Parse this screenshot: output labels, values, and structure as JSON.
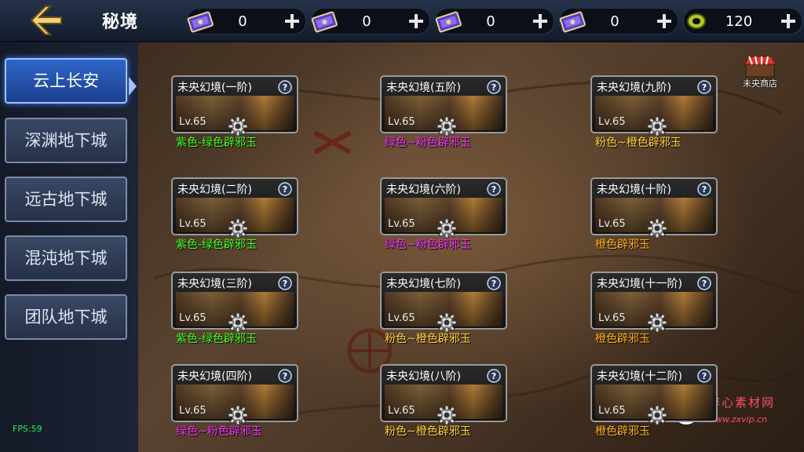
{
  "header": {
    "title": "秘境",
    "currencies": [
      {
        "icon": "purple-ticket-icon",
        "value": "0"
      },
      {
        "icon": "purple-ticket-icon",
        "value": "0"
      },
      {
        "icon": "purple-ticket-icon",
        "value": "0"
      },
      {
        "icon": "purple-ticket-icon",
        "value": "0"
      },
      {
        "icon": "gold-ring-coin-icon",
        "value": "120"
      }
    ]
  },
  "sidebar": {
    "items": [
      {
        "label": "云上长安",
        "active": true
      },
      {
        "label": "深渊地下城",
        "active": false
      },
      {
        "label": "远古地下城",
        "active": false
      },
      {
        "label": "混沌地下城",
        "active": false
      },
      {
        "label": "团队地下城",
        "active": false
      }
    ]
  },
  "shop": {
    "label": "未央商店"
  },
  "cards": [
    {
      "title": "未央幻境(一阶)",
      "level": "Lv.65",
      "reward": "紫色-绿色辟邪玉"
    },
    {
      "title": "未央幻境(五阶)",
      "level": "Lv.65",
      "reward": "绿色~粉色辟邪玉"
    },
    {
      "title": "未央幻境(九阶)",
      "level": "Lv.65",
      "reward": "粉色~橙色辟邪玉"
    },
    {
      "title": "未央幻境(二阶)",
      "level": "Lv.65",
      "reward": "紫色-绿色辟邪玉"
    },
    {
      "title": "未央幻境(六阶)",
      "level": "Lv.65",
      "reward": "绿色~粉色辟邪玉"
    },
    {
      "title": "未央幻境(十阶)",
      "level": "Lv.65",
      "reward": "橙色辟邪玉"
    },
    {
      "title": "未央幻境(三阶)",
      "level": "Lv.65",
      "reward": "紫色-绿色辟邪玉"
    },
    {
      "title": "未央幻境(七阶)",
      "level": "Lv.65",
      "reward": "粉色~橙色辟邪玉"
    },
    {
      "title": "未央幻境(十一阶)",
      "level": "Lv.65",
      "reward": "橙色辟邪玉"
    },
    {
      "title": "未央幻境(四阶)",
      "level": "Lv.65",
      "reward": "绿色~粉色辟邪玉"
    },
    {
      "title": "未央幻境(八阶)",
      "level": "Lv.65",
      "reward": "粉色~橙色辟邪玉"
    },
    {
      "title": "未央幻境(十二阶)",
      "level": "Lv.65",
      "reward": "橙色辟邪玉"
    }
  ],
  "reward_colors": {
    "紫色-绿色辟邪玉": "#44ff22",
    "绿色~粉色辟邪玉": "#ee33ee",
    "粉色~橙色辟邪玉": "#ffd23a",
    "橙色辟邪玉": "#ffb020"
  },
  "debug": {
    "fps": "FPS:59"
  },
  "watermark": {
    "title": "醉心素材网",
    "url": "www.zxvip.cn"
  }
}
